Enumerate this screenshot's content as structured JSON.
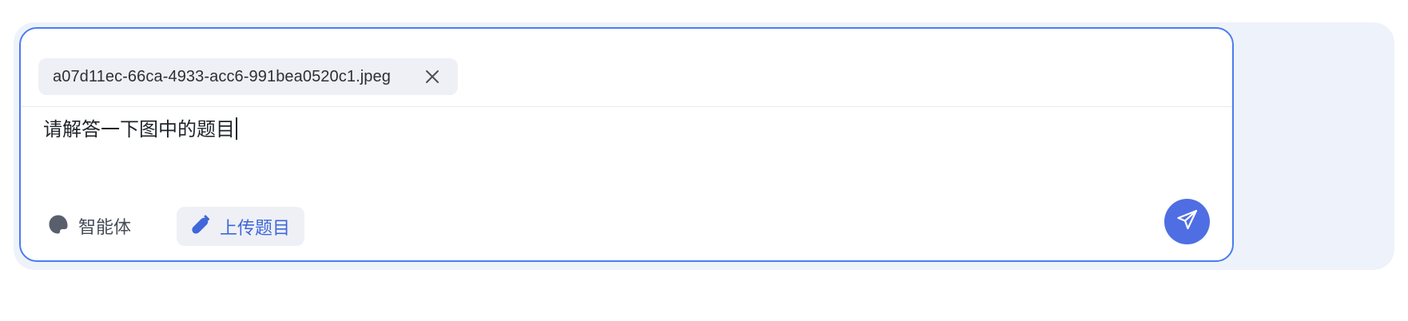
{
  "attachment": {
    "file_name": "a07d11ec-66ca-4933-acc6-991bea0520c1.jpeg",
    "remove_icon": "close-icon"
  },
  "input": {
    "value": "请解答一下图中的题目"
  },
  "toolbar": {
    "agent_label": "智能体",
    "agent_icon": "agent-icon",
    "upload_label": "上传题目",
    "upload_icon": "paperclip-icon",
    "send_icon": "send-icon"
  },
  "colors": {
    "accent": "#4f6ee3",
    "border": "#4a7cf0",
    "upload_text": "#3f67d9",
    "chip_bg": "#eef0f5"
  }
}
